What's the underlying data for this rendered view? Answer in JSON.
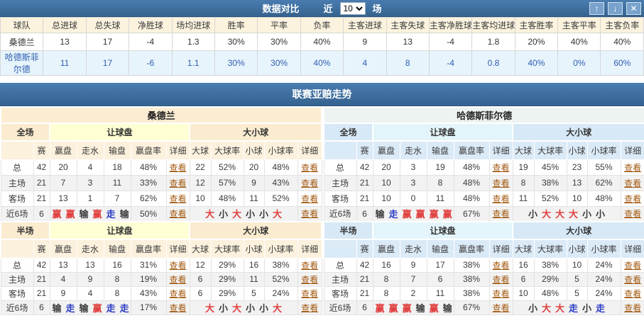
{
  "topbar": {
    "title": "数据对比",
    "near_label": "近",
    "rounds": "10",
    "unit_label": "场",
    "up_icon": "↑",
    "down_icon": "↓",
    "close_icon": "✕"
  },
  "comparison_table": {
    "headers": [
      "球队",
      "总进球",
      "总失球",
      "净胜球",
      "场均进球",
      "胜率",
      "平率",
      "负率",
      "主客进球",
      "主客失球",
      "主客净胜球",
      "主客均进球",
      "主客胜率",
      "主客平率",
      "主客负率"
    ],
    "rows": [
      {
        "cells": [
          "桑德兰",
          "13",
          "17",
          "-4",
          "1.3",
          "30%",
          "30%",
          "40%",
          "9",
          "13",
          "-4",
          "1.8",
          "20%",
          "40%",
          "40%"
        ]
      },
      {
        "cells": [
          "哈德斯菲尔德",
          "11",
          "17",
          "-6",
          "1.1",
          "30%",
          "30%",
          "40%",
          "4",
          "8",
          "-4",
          "0.8",
          "40%",
          "0%",
          "60%"
        ]
      }
    ]
  },
  "trend": {
    "title": "联赛亚赔走势",
    "labels": {
      "full": "全场",
      "half": "半场",
      "handicap": "让球盘",
      "over_under": "大小球",
      "columns": [
        "赛",
        "赢盘",
        "走水",
        "输盘",
        "赢盘率",
        "详细",
        "大球",
        "大球率",
        "小球",
        "小球率",
        "详细"
      ],
      "view": "查看",
      "recent": "近6场"
    },
    "colors": {
      "red": "#e03e3e",
      "blue": "#2b3cc3",
      "black": "#3b3b3b"
    },
    "panels": [
      {
        "team": "桑德兰",
        "theme": "cream",
        "full": {
          "rows": [
            {
              "label": "总",
              "games": "42",
              "handicap": [
                "20",
                "4",
                "18",
                "48%"
              ],
              "ou": [
                "22",
                "52%",
                "20",
                "48%"
              ]
            },
            {
              "label": "主场",
              "games": "21",
              "handicap": [
                "7",
                "3",
                "11",
                "33%"
              ],
              "ou": [
                "12",
                "57%",
                "9",
                "43%"
              ]
            },
            {
              "label": "客场",
              "games": "21",
              "handicap": [
                "13",
                "1",
                "7",
                "62%"
              ],
              "ou": [
                "10",
                "48%",
                "11",
                "52%"
              ]
            }
          ],
          "recent": {
            "games": "6",
            "handicap_seq": [
              [
                "赢",
                "red"
              ],
              [
                "赢",
                "red"
              ],
              [
                "输",
                "black"
              ],
              [
                "赢",
                "red"
              ],
              [
                "走",
                "blue"
              ],
              [
                "输",
                "black"
              ]
            ],
            "rate": "50%",
            "ou_seq": [
              [
                "大",
                "red"
              ],
              [
                "小",
                "black"
              ],
              [
                "大",
                "red"
              ],
              [
                "小",
                "black"
              ],
              [
                "小",
                "black"
              ],
              [
                "大",
                "red"
              ]
            ]
          }
        },
        "half": {
          "rows": [
            {
              "label": "总",
              "games": "42",
              "handicap": [
                "13",
                "13",
                "16",
                "31%"
              ],
              "ou": [
                "12",
                "29%",
                "16",
                "38%"
              ]
            },
            {
              "label": "主场",
              "games": "21",
              "handicap": [
                "4",
                "9",
                "8",
                "19%"
              ],
              "ou": [
                "6",
                "29%",
                "11",
                "52%"
              ]
            },
            {
              "label": "客场",
              "games": "21",
              "handicap": [
                "9",
                "4",
                "8",
                "43%"
              ],
              "ou": [
                "6",
                "29%",
                "5",
                "24%"
              ]
            }
          ],
          "recent": {
            "games": "6",
            "handicap_seq": [
              [
                "输",
                "black"
              ],
              [
                "走",
                "blue"
              ],
              [
                "输",
                "black"
              ],
              [
                "赢",
                "red"
              ],
              [
                "走",
                "blue"
              ],
              [
                "走",
                "blue"
              ]
            ],
            "rate": "17%",
            "ou_seq": [
              [
                "大",
                "red"
              ],
              [
                "小",
                "black"
              ],
              [
                "大",
                "red"
              ],
              [
                "小",
                "black"
              ],
              [
                "小",
                "black"
              ],
              [
                "大",
                "red"
              ]
            ]
          }
        }
      },
      {
        "team": "哈德斯菲尔德",
        "theme": "blue",
        "full": {
          "rows": [
            {
              "label": "总",
              "games": "42",
              "handicap": [
                "20",
                "3",
                "19",
                "48%"
              ],
              "ou": [
                "19",
                "45%",
                "23",
                "55%"
              ]
            },
            {
              "label": "主场",
              "games": "21",
              "handicap": [
                "10",
                "3",
                "8",
                "48%"
              ],
              "ou": [
                "8",
                "38%",
                "13",
                "62%"
              ]
            },
            {
              "label": "客场",
              "games": "21",
              "handicap": [
                "10",
                "0",
                "11",
                "48%"
              ],
              "ou": [
                "11",
                "52%",
                "10",
                "48%"
              ]
            }
          ],
          "recent": {
            "games": "6",
            "handicap_seq": [
              [
                "输",
                "black"
              ],
              [
                "走",
                "blue"
              ],
              [
                "赢",
                "red"
              ],
              [
                "赢",
                "red"
              ],
              [
                "赢",
                "red"
              ],
              [
                "赢",
                "red"
              ]
            ],
            "rate": "67%",
            "ou_seq": [
              [
                "小",
                "black"
              ],
              [
                "大",
                "red"
              ],
              [
                "大",
                "red"
              ],
              [
                "大",
                "red"
              ],
              [
                "小",
                "black"
              ],
              [
                "小",
                "black"
              ]
            ]
          }
        },
        "half": {
          "rows": [
            {
              "label": "总",
              "games": "42",
              "handicap": [
                "16",
                "9",
                "17",
                "38%"
              ],
              "ou": [
                "16",
                "38%",
                "10",
                "24%"
              ]
            },
            {
              "label": "主场",
              "games": "21",
              "handicap": [
                "8",
                "7",
                "6",
                "38%"
              ],
              "ou": [
                "6",
                "29%",
                "5",
                "24%"
              ]
            },
            {
              "label": "客场",
              "games": "21",
              "handicap": [
                "8",
                "2",
                "11",
                "38%"
              ],
              "ou": [
                "10",
                "48%",
                "5",
                "24%"
              ]
            }
          ],
          "recent": {
            "games": "6",
            "handicap_seq": [
              [
                "赢",
                "red"
              ],
              [
                "赢",
                "red"
              ],
              [
                "赢",
                "red"
              ],
              [
                "输",
                "black"
              ],
              [
                "赢",
                "red"
              ],
              [
                "输",
                "black"
              ]
            ],
            "rate": "67%",
            "ou_seq": [
              [
                "小",
                "black"
              ],
              [
                "大",
                "red"
              ],
              [
                "大",
                "red"
              ],
              [
                "走",
                "blue"
              ],
              [
                "小",
                "black"
              ],
              [
                "走",
                "blue"
              ]
            ]
          }
        }
      }
    ]
  }
}
